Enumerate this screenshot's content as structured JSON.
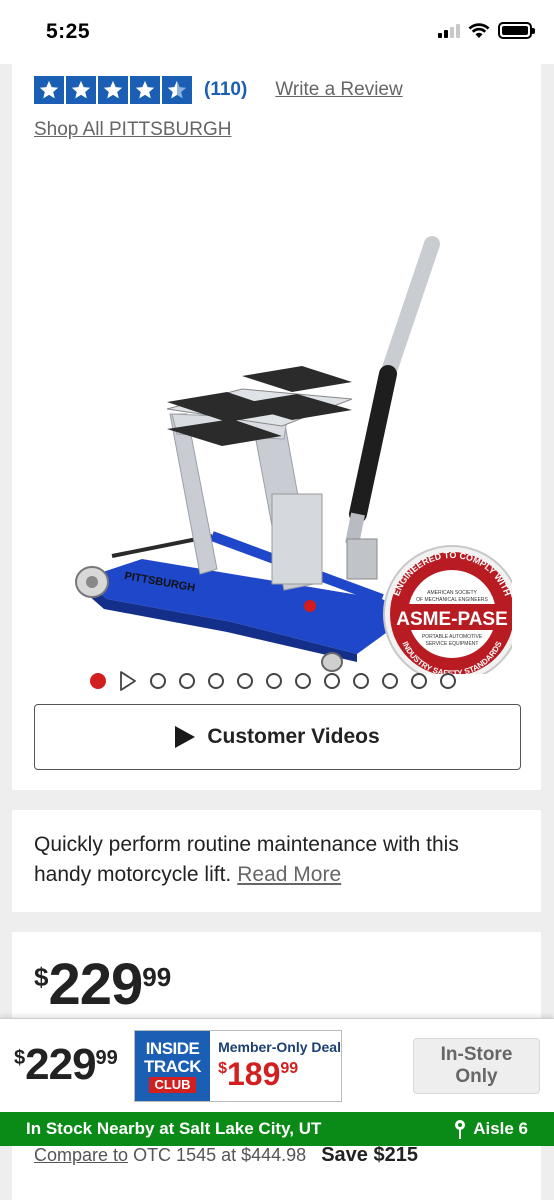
{
  "status_bar": {
    "time": "5:25"
  },
  "rating": {
    "stars": 4.5,
    "count": "(110)",
    "write_review": "Write a Review"
  },
  "brand": {
    "shop_all": "Shop All PITTSBURGH"
  },
  "image": {
    "brand_name": "PITTSBURGH",
    "badge": {
      "top_arc": "ENGINEERED TO COMPLY WITH",
      "line1": "AMERICAN SOCIETY",
      "line2": "OF MECHANICAL ENGINEERS",
      "main": "ASME-PASE",
      "line3": "PORTABLE AUTOMOTIVE",
      "line4": "SERVICE EQUIPMENT",
      "bottom_arc": "INDUSTRY SAFETY STANDARDS"
    }
  },
  "carousel": {
    "total_items": 13,
    "active_index": 0,
    "video_index": 1
  },
  "videos": {
    "label": "Customer Videos"
  },
  "description": {
    "text": "Quickly perform routine maintenance with this handy motorcycle lift.",
    "read_more": "Read More"
  },
  "price": {
    "symbol": "$",
    "dollars": "229",
    "cents": "99"
  },
  "compare": {
    "label": "Compare to",
    "text": "OTC 1545 at $444.98",
    "save": "Save $215"
  },
  "sticky": {
    "price": {
      "symbol": "$",
      "dollars": "229",
      "cents": "99"
    },
    "itc": {
      "line1": "INSIDE",
      "line2": "TRACK",
      "line3": "CLUB"
    },
    "deal_label": "Member-Only Deal",
    "deal_price": {
      "symbol": "$",
      "dollars": "189",
      "cents": "99"
    },
    "instore_line1": "In-Store",
    "instore_line2": "Only"
  },
  "stock": {
    "text": "In Stock Nearby at Salt Lake City, UT",
    "aisle": "Aisle 6"
  },
  "colors": {
    "brand_blue": "#1b5fb4",
    "accent_red": "#d21f1f",
    "stock_green": "#0a8a16"
  }
}
